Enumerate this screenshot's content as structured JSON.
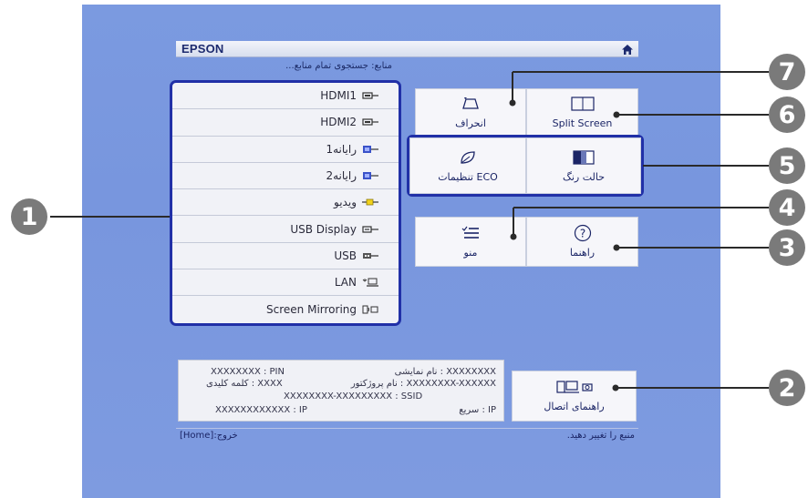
{
  "brand": "EPSON",
  "search_status": "منابع: جستجوی تمام منابع...",
  "sources": [
    {
      "label": "HDMI1",
      "icon": "hdmi-icon"
    },
    {
      "label": "HDMI2",
      "icon": "hdmi-icon"
    },
    {
      "label": "رایانه1",
      "icon": "computer-port-icon"
    },
    {
      "label": "رایانه2",
      "icon": "computer-port-icon"
    },
    {
      "label": "ویدیو",
      "icon": "video-port-icon"
    },
    {
      "label": "USB Display",
      "icon": "usb-display-icon"
    },
    {
      "label": "USB",
      "icon": "usb-icon"
    },
    {
      "label": "LAN",
      "icon": "lan-icon"
    },
    {
      "label": "Screen Mirroring",
      "icon": "screen-mirroring-icon"
    }
  ],
  "tiles": {
    "keystone": "انحراف",
    "split_screen": "Split Screen",
    "eco": "تنظیمات ECO",
    "color_mode": "حالت رنگ",
    "menu": "منو",
    "help": "راهنما",
    "connection_guide": "راهنمای اتصال",
    "split_icon_text": "1 2"
  },
  "info": {
    "display_name": "نام نمایشی : XXXXXXXX",
    "pin": "XXXXXXXX : PIN",
    "projector_name": "نام پروژکتور : XXXXXXXX-XXXXXX",
    "keyword": "کلمه کلیدی : XXXX",
    "ssid": "XXXXXXXX-XXXXXXXXX : SSID",
    "ip_wireless": "سریع : IP",
    "ip_wired": "XXXXXXXXXXXX : IP"
  },
  "footer": {
    "exit": "[Home]:خروج",
    "change_source": "منبع را تغییر دهید."
  },
  "callouts": [
    "1",
    "2",
    "3",
    "4",
    "5",
    "6",
    "7"
  ],
  "colors": {
    "background": "#7b9ae0",
    "selection_border": "#2130a7",
    "callout": "#7a7a7a"
  }
}
